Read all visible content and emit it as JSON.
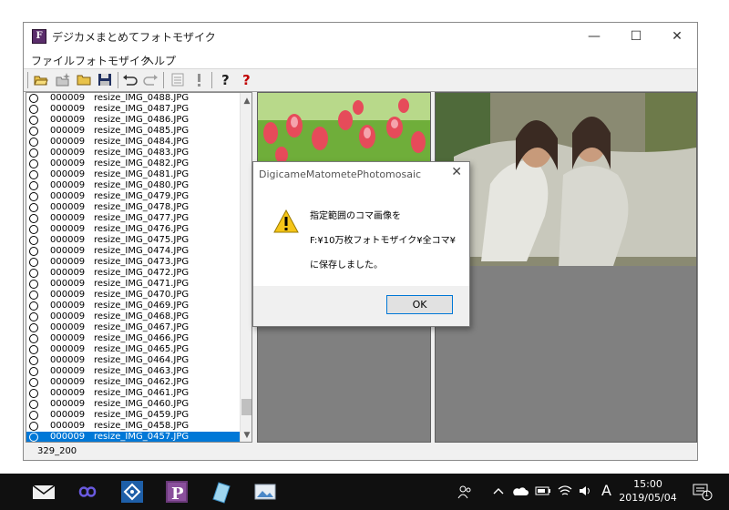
{
  "window": {
    "title": "デジカメまとめてフォトモザイク",
    "app_icon_letter": "F",
    "controls": {
      "minimize": "—",
      "maximize": "☐",
      "close": "✕"
    }
  },
  "menu": [
    "ファイル",
    "フォトモザイク",
    "ヘルプ"
  ],
  "toolbar_icons": [
    "open-folder-icon",
    "new-folder-icon",
    "folder-icon",
    "save-icon",
    "undo-icon",
    "redo-icon",
    "list-icon",
    "exclamation-icon",
    "help-icon",
    "context-help-icon"
  ],
  "file_list": [
    {
      "num": "000009",
      "name": "resize_IMG_0488.JPG"
    },
    {
      "num": "000009",
      "name": "resize_IMG_0487.JPG"
    },
    {
      "num": "000009",
      "name": "resize_IMG_0486.JPG"
    },
    {
      "num": "000009",
      "name": "resize_IMG_0485.JPG"
    },
    {
      "num": "000009",
      "name": "resize_IMG_0484.JPG"
    },
    {
      "num": "000009",
      "name": "resize_IMG_0483.JPG"
    },
    {
      "num": "000009",
      "name": "resize_IMG_0482.JPG"
    },
    {
      "num": "000009",
      "name": "resize_IMG_0481.JPG"
    },
    {
      "num": "000009",
      "name": "resize_IMG_0480.JPG"
    },
    {
      "num": "000009",
      "name": "resize_IMG_0479.JPG"
    },
    {
      "num": "000009",
      "name": "resize_IMG_0478.JPG"
    },
    {
      "num": "000009",
      "name": "resize_IMG_0477.JPG"
    },
    {
      "num": "000009",
      "name": "resize_IMG_0476.JPG"
    },
    {
      "num": "000009",
      "name": "resize_IMG_0475.JPG"
    },
    {
      "num": "000009",
      "name": "resize_IMG_0474.JPG"
    },
    {
      "num": "000009",
      "name": "resize_IMG_0473.JPG"
    },
    {
      "num": "000009",
      "name": "resize_IMG_0472.JPG"
    },
    {
      "num": "000009",
      "name": "resize_IMG_0471.JPG"
    },
    {
      "num": "000009",
      "name": "resize_IMG_0470.JPG"
    },
    {
      "num": "000009",
      "name": "resize_IMG_0469.JPG"
    },
    {
      "num": "000009",
      "name": "resize_IMG_0468.JPG"
    },
    {
      "num": "000009",
      "name": "resize_IMG_0467.JPG"
    },
    {
      "num": "000009",
      "name": "resize_IMG_0466.JPG"
    },
    {
      "num": "000009",
      "name": "resize_IMG_0465.JPG"
    },
    {
      "num": "000009",
      "name": "resize_IMG_0464.JPG"
    },
    {
      "num": "000009",
      "name": "resize_IMG_0463.JPG"
    },
    {
      "num": "000009",
      "name": "resize_IMG_0462.JPG"
    },
    {
      "num": "000009",
      "name": "resize_IMG_0461.JPG"
    },
    {
      "num": "000009",
      "name": "resize_IMG_0460.JPG"
    },
    {
      "num": "000009",
      "name": "resize_IMG_0459.JPG"
    },
    {
      "num": "000009",
      "name": "resize_IMG_0458.JPG"
    },
    {
      "num": "000009",
      "name": "resize_IMG_0457.JPG",
      "selected": true
    }
  ],
  "status": "329_200",
  "dialog": {
    "title": "DigicameMatometePhotomosaic",
    "lines": [
      "指定範囲のコマ画像を",
      "F:¥10万枚フォトモザイク¥全コマ¥",
      "に保存しました。"
    ],
    "ok_label": "OK",
    "icon": "warning-icon"
  },
  "taskbar": {
    "time": "15:00",
    "date": "2019/05/04",
    "ime": "A",
    "notification_count": "1"
  },
  "colors": {
    "selection": "#0078d7",
    "taskbar": "#101010",
    "pane_gray": "#808080"
  }
}
